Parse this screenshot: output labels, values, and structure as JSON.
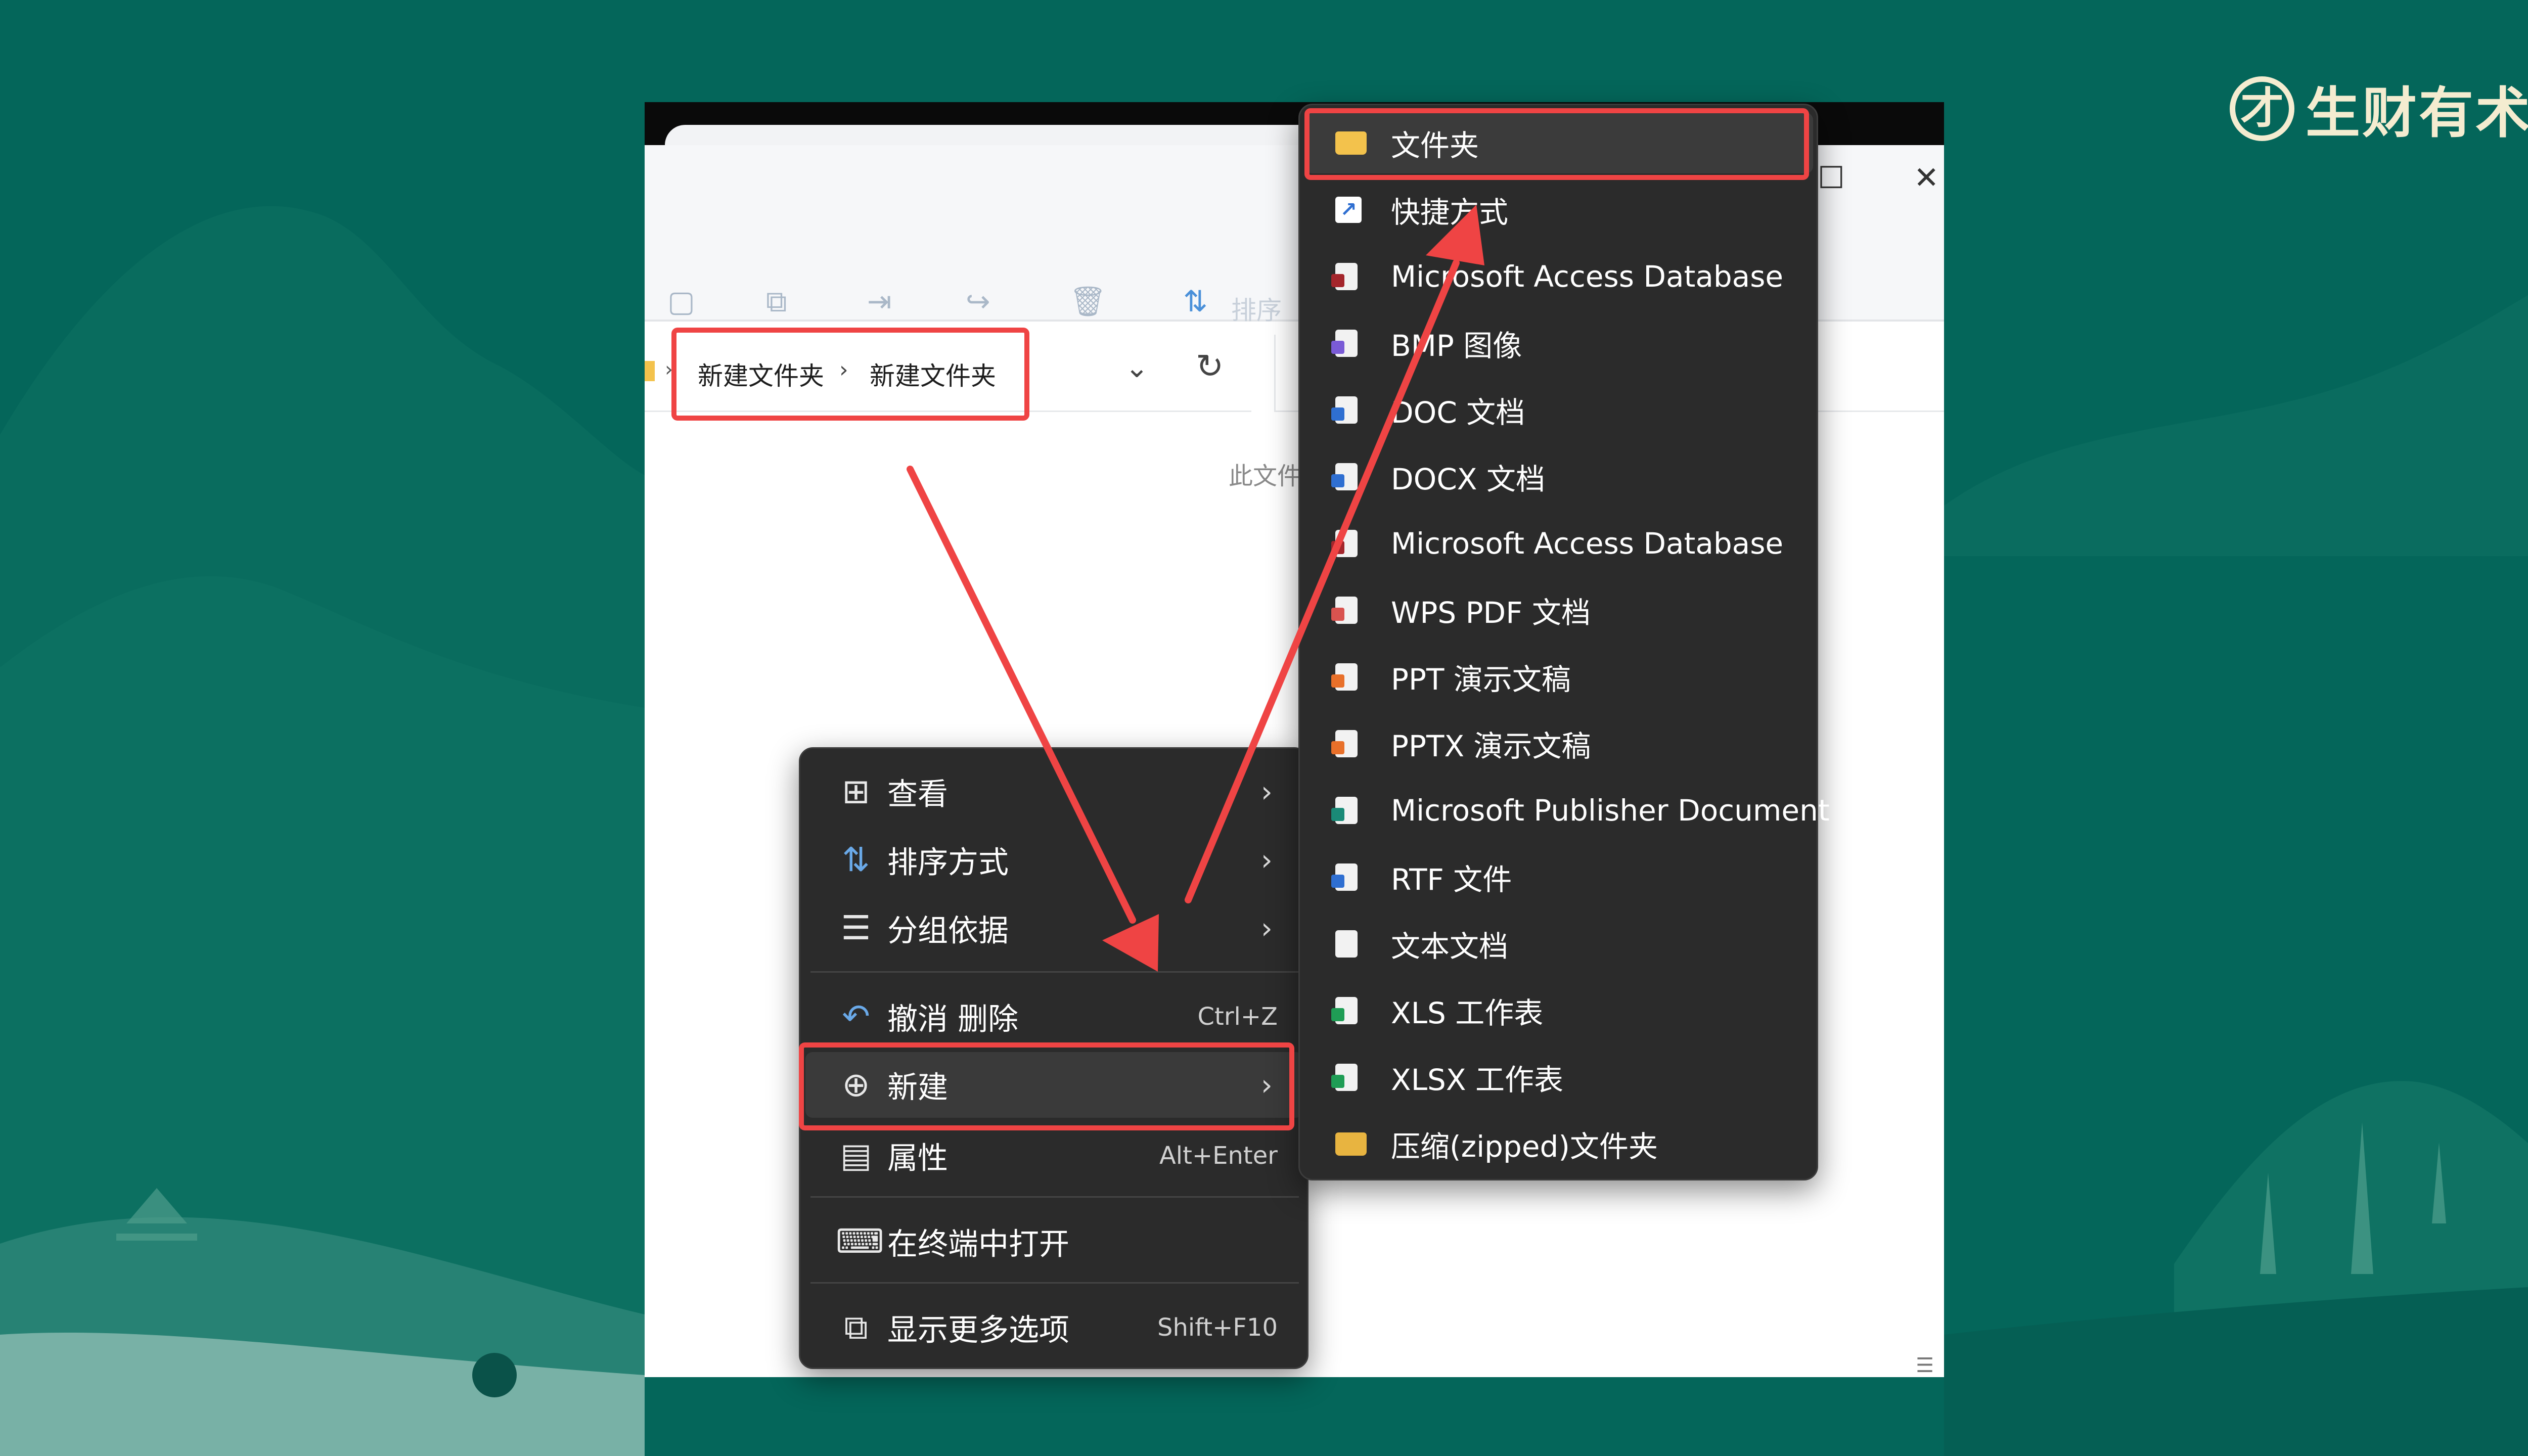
{
  "brand": {
    "mark": "才",
    "name": "生财有术"
  },
  "window": {
    "toolbar_sort_label": "排序",
    "breadcrumb": [
      "新建文件夹",
      "新建文件夹"
    ],
    "breadcrumb_sep": "›",
    "empty_note": "此文件夹"
  },
  "context_menu": {
    "items": [
      {
        "label": "查看",
        "icon": "grid-icon",
        "has_submenu": true
      },
      {
        "label": "排序方式",
        "icon": "sort-icon",
        "has_submenu": true
      },
      {
        "label": "分组依据",
        "icon": "list-icon",
        "has_submenu": true
      },
      {
        "label": "撤消 删除",
        "icon": "undo-icon",
        "shortcut": "Ctrl+Z"
      },
      {
        "label": "新建",
        "icon": "new-circle-icon",
        "has_submenu": true,
        "highlighted": true
      },
      {
        "label": "属性",
        "icon": "properties-icon",
        "shortcut": "Alt+Enter"
      },
      {
        "label": "在终端中打开",
        "icon": "terminal-icon"
      },
      {
        "label": "显示更多选项",
        "icon": "more-options-icon",
        "shortcut": "Shift+F10"
      }
    ]
  },
  "new_submenu": {
    "items": [
      {
        "label": "文件夹",
        "icon": "folder-icon",
        "highlighted": true
      },
      {
        "label": "快捷方式",
        "icon": "shortcut-icon"
      },
      {
        "label": "Microsoft Access Database",
        "icon": "access-icon"
      },
      {
        "label": "BMP 图像",
        "icon": "bmp-icon"
      },
      {
        "label": "DOC 文档",
        "icon": "doc-icon"
      },
      {
        "label": "DOCX 文档",
        "icon": "docx-icon"
      },
      {
        "label": "Microsoft Access Database",
        "icon": "access-icon"
      },
      {
        "label": "WPS PDF 文档",
        "icon": "pdf-icon"
      },
      {
        "label": "PPT 演示文稿",
        "icon": "ppt-icon"
      },
      {
        "label": "PPTX 演示文稿",
        "icon": "pptx-icon"
      },
      {
        "label": "Microsoft Publisher Document",
        "icon": "publisher-icon"
      },
      {
        "label": "RTF 文件",
        "icon": "rtf-icon"
      },
      {
        "label": "文本文档",
        "icon": "text-file-icon"
      },
      {
        "label": "XLS 工作表",
        "icon": "xls-icon"
      },
      {
        "label": "XLSX 工作表",
        "icon": "xlsx-icon"
      },
      {
        "label": "压缩(zipped)文件夹",
        "icon": "zip-folder-icon"
      }
    ]
  },
  "colors": {
    "background": "#04665a",
    "menu": "#2b2b2b",
    "highlight_red": "#ef4444",
    "brand_cream": "#f4ecd0",
    "access_badge": "#a4262c",
    "word_badge": "#2f6fd1",
    "pdf_badge": "#d9534f",
    "ppt_badge": "#e8702a",
    "publisher_badge": "#1a8a77",
    "excel_badge": "#1f9d55"
  }
}
